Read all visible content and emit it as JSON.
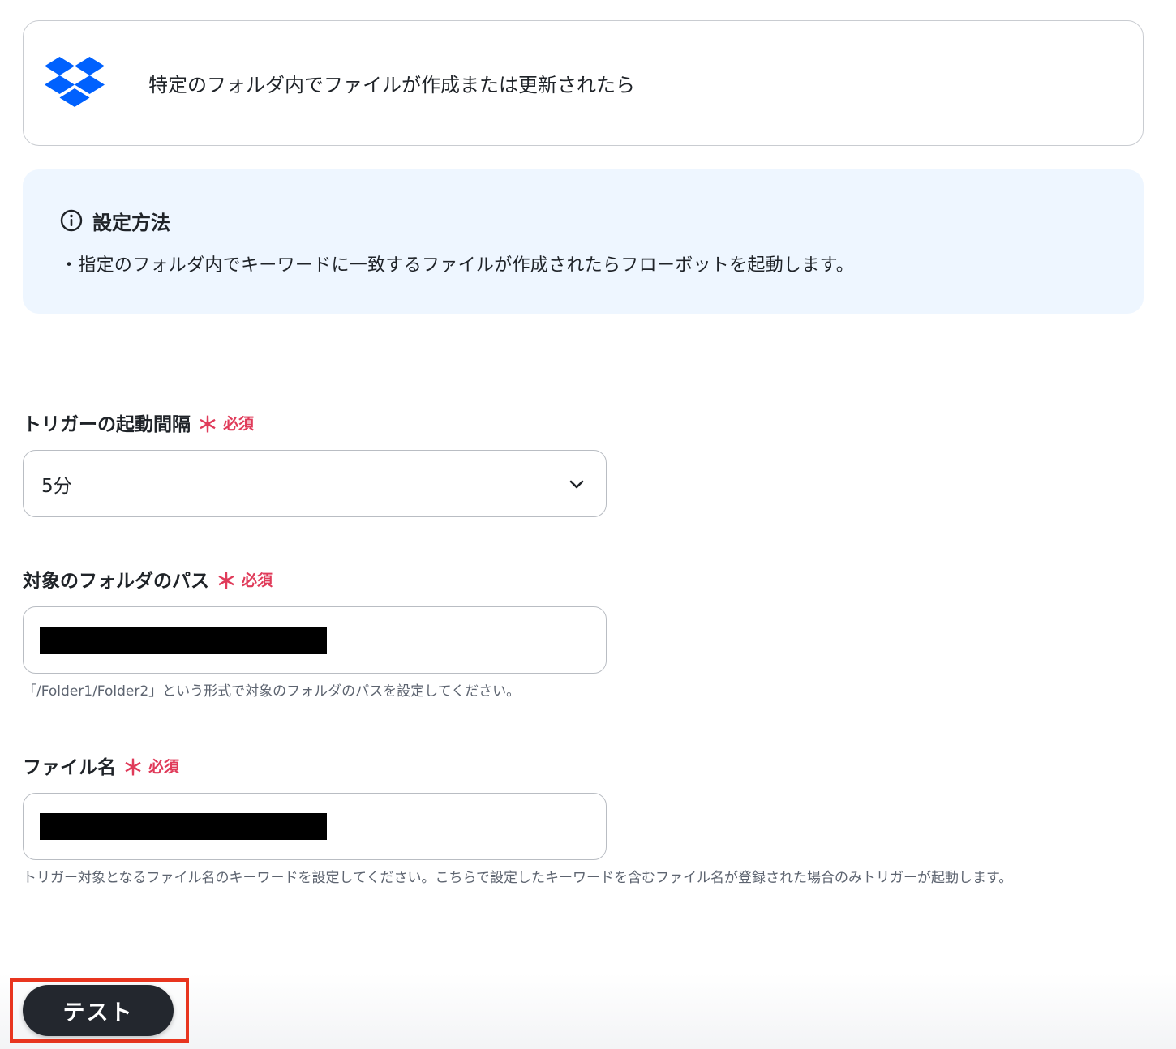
{
  "trigger": {
    "title": "特定のフォルダ内でファイルが作成または更新されたら",
    "app_icon": "dropbox-logo",
    "brand_color": "#0061fe"
  },
  "info": {
    "icon": "info-circle-icon",
    "title": "設定方法",
    "text": "・指定のフォルダ内でキーワードに一致するファイルが作成されたらフローボットを起動します。"
  },
  "fields": {
    "interval": {
      "label": "トリガーの起動間隔",
      "required_mark": "＊",
      "required_text": "必須",
      "selected_value": "5分"
    },
    "folder_path": {
      "label": "対象のフォルダのパス",
      "required_mark": "＊",
      "required_text": "必須",
      "help": "「/Folder1/Folder2」という形式で対象のフォルダのパスを設定してください。"
    },
    "file_name": {
      "label": "ファイル名",
      "required_mark": "＊",
      "required_text": "必須",
      "help": "トリガー対象となるファイル名のキーワードを設定してください。こちらで設定したキーワードを含むファイル名が登録された場合のみトリガーが起動します。"
    }
  },
  "actions": {
    "test_label": "テスト"
  },
  "colors": {
    "required": "#e03b5a",
    "info_bg": "#eef6ff",
    "button_bg": "#23272e",
    "highlight": "#e8351f"
  }
}
